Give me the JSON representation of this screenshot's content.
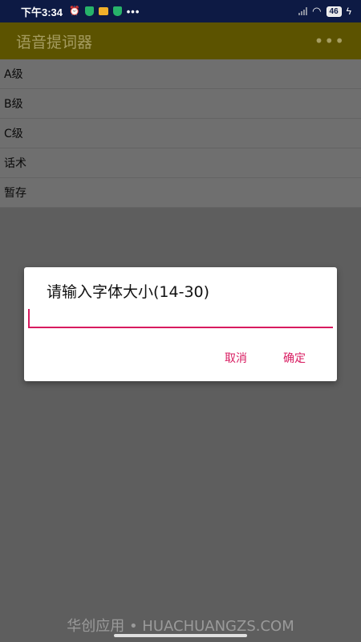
{
  "status_bar": {
    "time": "下午3:34",
    "more": "•••",
    "battery": "46"
  },
  "app_bar": {
    "title": "语音提词器",
    "overflow": "⋮"
  },
  "list": [
    {
      "label": "A级"
    },
    {
      "label": "B级"
    },
    {
      "label": "C级"
    },
    {
      "label": "话术"
    },
    {
      "label": "暂存"
    }
  ],
  "dialog": {
    "title": "请输入字体大小(14-30)",
    "input_value": "",
    "cancel": "取消",
    "confirm": "确定"
  },
  "watermark": "华创应用 • HUACHUANGZS.COM",
  "colors": {
    "accent": "#d81b60",
    "appbar": "#5c5300",
    "statusbar": "#0d1a44"
  }
}
